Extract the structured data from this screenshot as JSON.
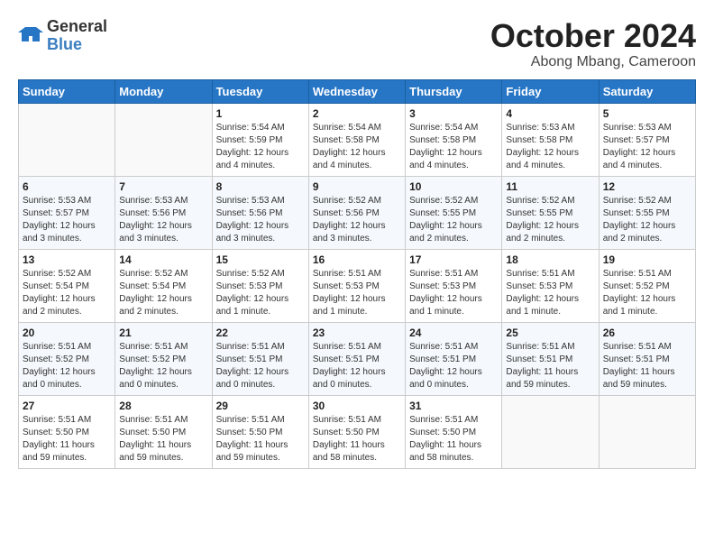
{
  "header": {
    "logo_line1": "General",
    "logo_line2": "Blue",
    "month": "October 2024",
    "location": "Abong Mbang, Cameroon"
  },
  "days_of_week": [
    "Sunday",
    "Monday",
    "Tuesday",
    "Wednesday",
    "Thursday",
    "Friday",
    "Saturday"
  ],
  "weeks": [
    [
      {
        "day": "",
        "info": ""
      },
      {
        "day": "",
        "info": ""
      },
      {
        "day": "1",
        "info": "Sunrise: 5:54 AM\nSunset: 5:59 PM\nDaylight: 12 hours\nand 4 minutes."
      },
      {
        "day": "2",
        "info": "Sunrise: 5:54 AM\nSunset: 5:58 PM\nDaylight: 12 hours\nand 4 minutes."
      },
      {
        "day": "3",
        "info": "Sunrise: 5:54 AM\nSunset: 5:58 PM\nDaylight: 12 hours\nand 4 minutes."
      },
      {
        "day": "4",
        "info": "Sunrise: 5:53 AM\nSunset: 5:58 PM\nDaylight: 12 hours\nand 4 minutes."
      },
      {
        "day": "5",
        "info": "Sunrise: 5:53 AM\nSunset: 5:57 PM\nDaylight: 12 hours\nand 4 minutes."
      }
    ],
    [
      {
        "day": "6",
        "info": "Sunrise: 5:53 AM\nSunset: 5:57 PM\nDaylight: 12 hours\nand 3 minutes."
      },
      {
        "day": "7",
        "info": "Sunrise: 5:53 AM\nSunset: 5:56 PM\nDaylight: 12 hours\nand 3 minutes."
      },
      {
        "day": "8",
        "info": "Sunrise: 5:53 AM\nSunset: 5:56 PM\nDaylight: 12 hours\nand 3 minutes."
      },
      {
        "day": "9",
        "info": "Sunrise: 5:52 AM\nSunset: 5:56 PM\nDaylight: 12 hours\nand 3 minutes."
      },
      {
        "day": "10",
        "info": "Sunrise: 5:52 AM\nSunset: 5:55 PM\nDaylight: 12 hours\nand 2 minutes."
      },
      {
        "day": "11",
        "info": "Sunrise: 5:52 AM\nSunset: 5:55 PM\nDaylight: 12 hours\nand 2 minutes."
      },
      {
        "day": "12",
        "info": "Sunrise: 5:52 AM\nSunset: 5:55 PM\nDaylight: 12 hours\nand 2 minutes."
      }
    ],
    [
      {
        "day": "13",
        "info": "Sunrise: 5:52 AM\nSunset: 5:54 PM\nDaylight: 12 hours\nand 2 minutes."
      },
      {
        "day": "14",
        "info": "Sunrise: 5:52 AM\nSunset: 5:54 PM\nDaylight: 12 hours\nand 2 minutes."
      },
      {
        "day": "15",
        "info": "Sunrise: 5:52 AM\nSunset: 5:53 PM\nDaylight: 12 hours\nand 1 minute."
      },
      {
        "day": "16",
        "info": "Sunrise: 5:51 AM\nSunset: 5:53 PM\nDaylight: 12 hours\nand 1 minute."
      },
      {
        "day": "17",
        "info": "Sunrise: 5:51 AM\nSunset: 5:53 PM\nDaylight: 12 hours\nand 1 minute."
      },
      {
        "day": "18",
        "info": "Sunrise: 5:51 AM\nSunset: 5:53 PM\nDaylight: 12 hours\nand 1 minute."
      },
      {
        "day": "19",
        "info": "Sunrise: 5:51 AM\nSunset: 5:52 PM\nDaylight: 12 hours\nand 1 minute."
      }
    ],
    [
      {
        "day": "20",
        "info": "Sunrise: 5:51 AM\nSunset: 5:52 PM\nDaylight: 12 hours\nand 0 minutes."
      },
      {
        "day": "21",
        "info": "Sunrise: 5:51 AM\nSunset: 5:52 PM\nDaylight: 12 hours\nand 0 minutes."
      },
      {
        "day": "22",
        "info": "Sunrise: 5:51 AM\nSunset: 5:51 PM\nDaylight: 12 hours\nand 0 minutes."
      },
      {
        "day": "23",
        "info": "Sunrise: 5:51 AM\nSunset: 5:51 PM\nDaylight: 12 hours\nand 0 minutes."
      },
      {
        "day": "24",
        "info": "Sunrise: 5:51 AM\nSunset: 5:51 PM\nDaylight: 12 hours\nand 0 minutes."
      },
      {
        "day": "25",
        "info": "Sunrise: 5:51 AM\nSunset: 5:51 PM\nDaylight: 11 hours\nand 59 minutes."
      },
      {
        "day": "26",
        "info": "Sunrise: 5:51 AM\nSunset: 5:51 PM\nDaylight: 11 hours\nand 59 minutes."
      }
    ],
    [
      {
        "day": "27",
        "info": "Sunrise: 5:51 AM\nSunset: 5:50 PM\nDaylight: 11 hours\nand 59 minutes."
      },
      {
        "day": "28",
        "info": "Sunrise: 5:51 AM\nSunset: 5:50 PM\nDaylight: 11 hours\nand 59 minutes."
      },
      {
        "day": "29",
        "info": "Sunrise: 5:51 AM\nSunset: 5:50 PM\nDaylight: 11 hours\nand 59 minutes."
      },
      {
        "day": "30",
        "info": "Sunrise: 5:51 AM\nSunset: 5:50 PM\nDaylight: 11 hours\nand 58 minutes."
      },
      {
        "day": "31",
        "info": "Sunrise: 5:51 AM\nSunset: 5:50 PM\nDaylight: 11 hours\nand 58 minutes."
      },
      {
        "day": "",
        "info": ""
      },
      {
        "day": "",
        "info": ""
      }
    ]
  ]
}
